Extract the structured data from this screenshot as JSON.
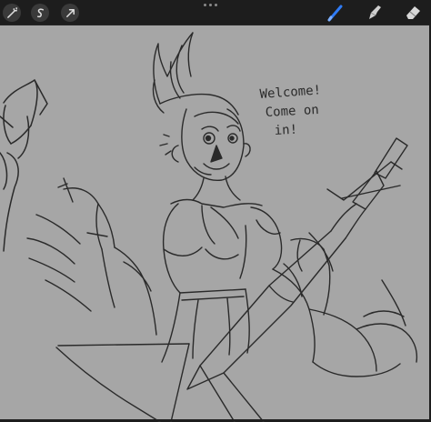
{
  "toolbar": {
    "left_tools": [
      {
        "name": "adjustments-icon"
      },
      {
        "name": "selection-icon"
      },
      {
        "name": "transform-icon"
      }
    ],
    "right_tools": [
      {
        "name": "brush-icon",
        "active": true
      },
      {
        "name": "smudge-icon",
        "active": false
      },
      {
        "name": "eraser-icon",
        "active": false
      }
    ],
    "active_color": "#2f7bf5"
  },
  "canvas": {
    "background": "#a6a6a6",
    "stroke_color": "#2a2a2a",
    "speech_lines": [
      "Welcome!",
      "Come on",
      "in!"
    ]
  }
}
